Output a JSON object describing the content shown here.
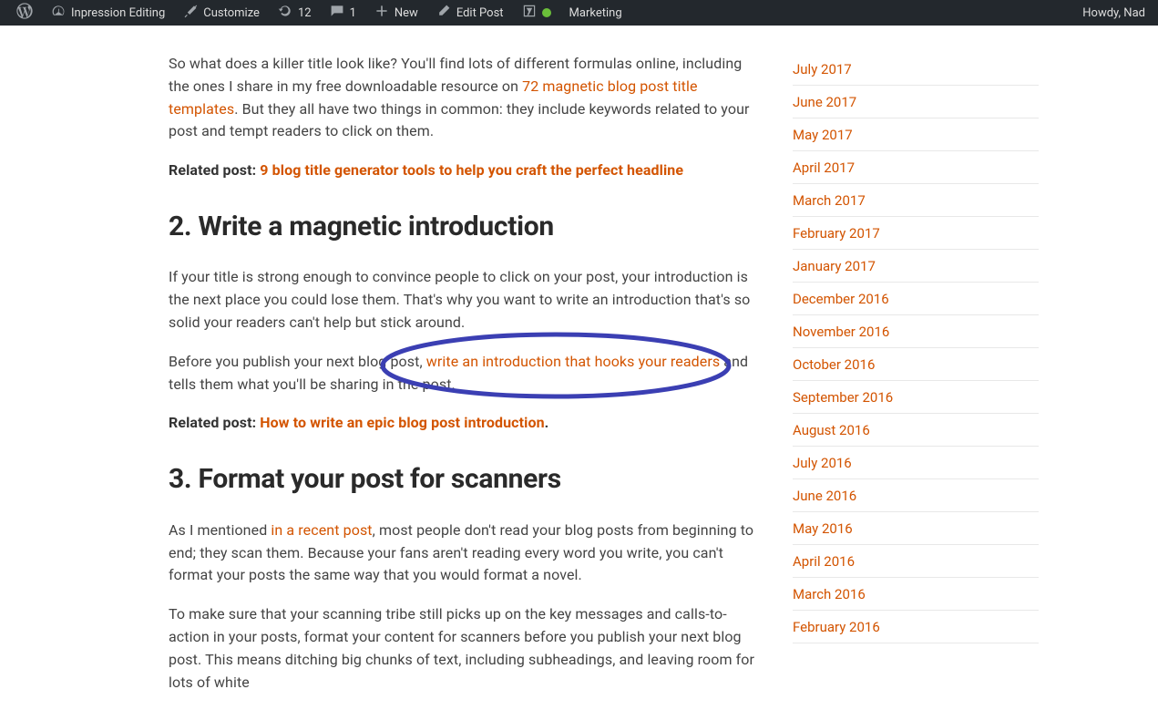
{
  "adminbar": {
    "site_name": "Inpression Editing",
    "customize": "Customize",
    "updates": "12",
    "comments": "1",
    "new": "New",
    "edit_post": "Edit Post",
    "marketing": "Marketing",
    "howdy": "Howdy, Nad"
  },
  "content": {
    "p1_a": "So what does a killer title look like? You'll find lots of different formulas online, including the ones I share in my free downloadable resource on ",
    "p1_link": "72 magnetic blog post title templates",
    "p1_b": ". But they all have two things in common: they include keywords related to your post and tempt readers to click on them.",
    "related1_label": "Related post: ",
    "related1_link": "9 blog title generator tools to help you craft the perfect headline",
    "h2a": "2. Write a magnetic introduction",
    "p2": "If your title is strong enough to convince people to click on your post, your introduction is the next place you could lose them. That's why you want to write an introduction that's so solid your readers can't help but stick around.",
    "p3_a": "Before you publish your next blog post, ",
    "p3_link": "write an introduction that hooks your readers",
    "p3_b": " and tells them what you'll be sharing in the post.",
    "related2_label": "Related post: ",
    "related2_link": "How to write an epic blog post introduction",
    "related2_dot": ".",
    "h2b": "3. Format your post for scanners",
    "p4_a": "As I mentioned ",
    "p4_link": "in a recent post",
    "p4_b": ", most people don't read your blog posts from beginning to end; they scan them. Because your fans aren't reading every word you write, you can't format your posts the same way that you would format a novel.",
    "p5": "To make sure that your scanning tribe still picks up on the key messages and calls-to-action in your posts, format your content for scanners before you publish your next blog post. This means ditching big chunks of text, including subheadings, and leaving room for lots of white"
  },
  "archives": [
    "July 2017",
    "June 2017",
    "May 2017",
    "April 2017",
    "March 2017",
    "February 2017",
    "January 2017",
    "December 2016",
    "November 2016",
    "October 2016",
    "September 2016",
    "August 2016",
    "July 2016",
    "June 2016",
    "May 2016",
    "April 2016",
    "March 2016",
    "February 2016"
  ]
}
